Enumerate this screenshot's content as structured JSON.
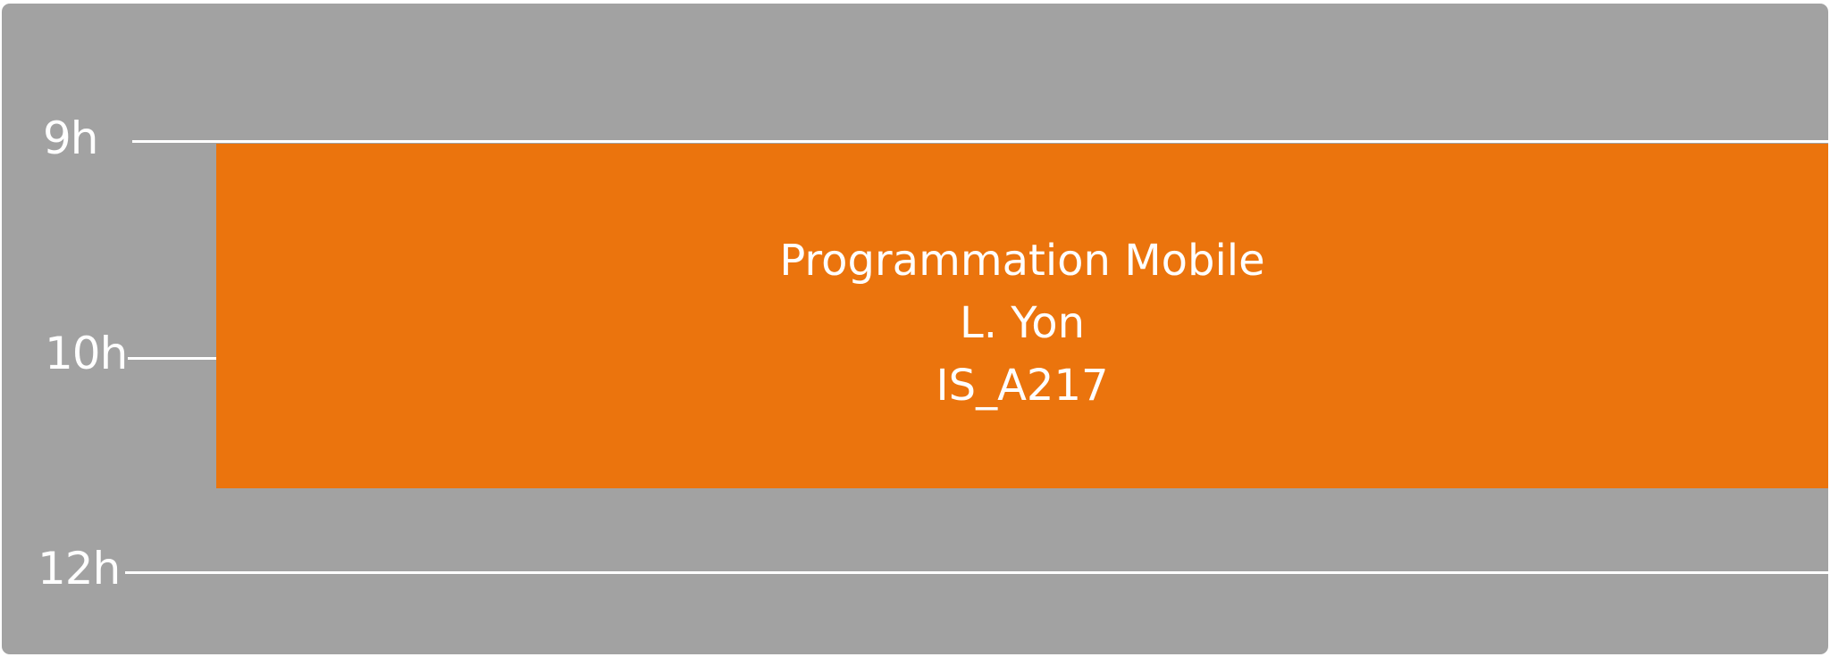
{
  "timetable": {
    "hours": [
      {
        "label": "9h"
      },
      {
        "label": "10h"
      },
      {
        "label": "12h"
      }
    ],
    "event": {
      "course": "Programmation Mobile",
      "teacher": "L. Yon",
      "room": "IS_A217",
      "color": "#eb740d"
    },
    "background_color": "#a2a2a2"
  }
}
